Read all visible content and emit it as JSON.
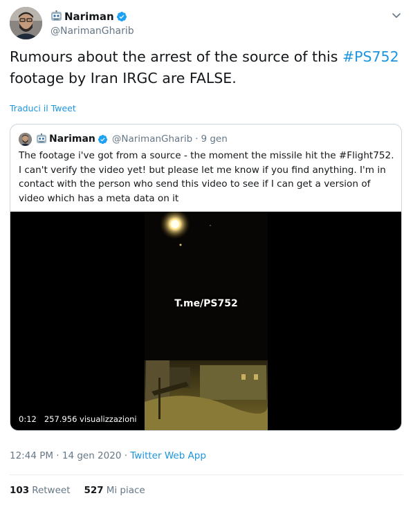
{
  "author": {
    "display_name": "Nariman",
    "handle": "@NarimanGharib",
    "verified": true,
    "name_emoji_icon": "robot-face-icon"
  },
  "tweet": {
    "text_before_hashtag": "Rumours about the arrest of the source of this ",
    "hashtag": "#PS752",
    "text_after_hashtag": " footage by Iran IRGC are FALSE.",
    "translate_label": "Traduci il Tweet",
    "timestamp": "12:44 PM · 14 gen 2020",
    "separator": " · ",
    "source_app": "Twitter Web App"
  },
  "quoted_tweet": {
    "display_name": "Nariman",
    "handle": "@NarimanGharib",
    "separator": "·",
    "date": "9 gen",
    "text_before_hashtag": "The footage i've got from a source - the moment the missile hit the ",
    "hashtag": "#Flight752",
    "text_after_hashtag": ". I can't verify the video yet! but please let me know if you find anything. I'm in contact with the person who send this video to see if I can get a version of video which has a meta data on it",
    "video": {
      "watermark": "T.me/PS752",
      "duration": "0:12",
      "views": "257.956 visualizzazioni"
    }
  },
  "stats": {
    "retweets_count": "103",
    "retweets_label": "Retweet",
    "likes_count": "527",
    "likes_label": "Mi piace"
  },
  "colors": {
    "link_blue": "#1b95e0",
    "secondary_text": "#657786",
    "border": "#ccd6dd",
    "verified_blue": "#1da1f2"
  }
}
